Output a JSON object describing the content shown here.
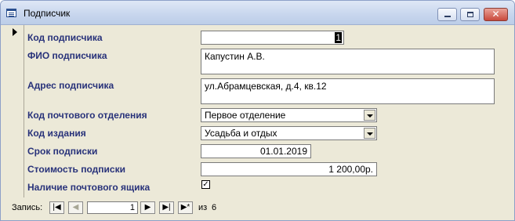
{
  "window": {
    "title": "Подписчик",
    "close_glyph": "✕"
  },
  "fields": {
    "subscriber_code": {
      "label": "Код подписчика",
      "value": "1"
    },
    "full_name": {
      "label": "ФИО подписчика",
      "value": "Капустин А.В."
    },
    "address": {
      "label": "Адрес подписчика",
      "value": "ул.Абрамцевская, д.4, кв.12"
    },
    "post_office_code": {
      "label": "Код почтового отделения",
      "value": "Первое отделение"
    },
    "edition_code": {
      "label": "Код издания",
      "value": "Усадьба и отдых"
    },
    "subscription_term": {
      "label": "Срок подписки",
      "value": "01.01.2019"
    },
    "subscription_cost": {
      "label": "Стоимость подписки",
      "value": "1 200,00р."
    },
    "mailbox": {
      "label": "Наличие почтового ящика",
      "checked": true,
      "mark": "✓"
    }
  },
  "navigation": {
    "label": "Запись:",
    "current_record": "1",
    "of_label": "из",
    "total_records": "6",
    "first_glyph": "|◀",
    "prev_glyph": "◀",
    "next_glyph": "▶",
    "last_glyph": "▶|",
    "new_glyph": "▶*"
  },
  "icons": {
    "title_icon": "form-icon",
    "record_selector": "current-record-arrow-icon"
  },
  "colors": {
    "label_text": "#28327a",
    "form_background": "#ece9d8",
    "close_button": "#c9493c"
  }
}
